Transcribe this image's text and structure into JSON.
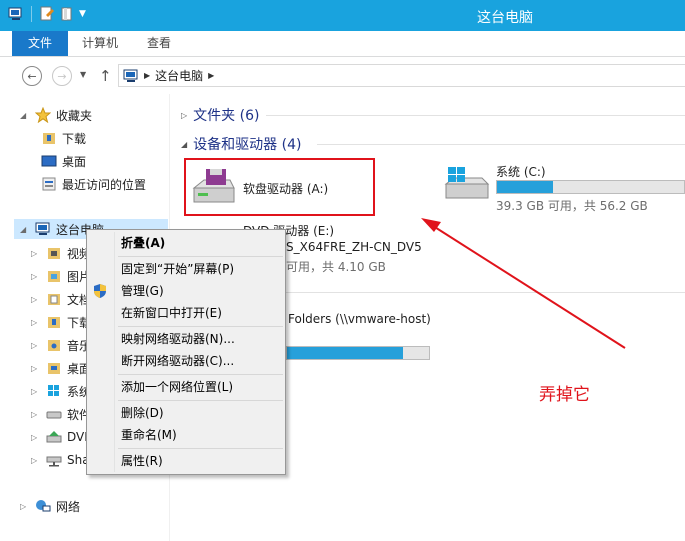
{
  "window": {
    "title": "这台电脑"
  },
  "ribbon": {
    "tabs": [
      "文件",
      "计算机",
      "查看"
    ]
  },
  "address": {
    "path": "这台电脑"
  },
  "nav": {
    "favorites": "收藏夹",
    "downloads": "下载",
    "desktop": "桌面",
    "recent": "最近访问的位置",
    "thispc": "这台电脑",
    "children": [
      "视频",
      "图片",
      "文档",
      "下载",
      "音乐",
      "桌面",
      "系统",
      "软件",
      "DVD",
      "Shar"
    ],
    "network": "网络"
  },
  "content": {
    "folders_group": "文件夹 (6)",
    "drives_group": "设备和驱动器 (4)",
    "floppy": {
      "label": "软盘驱动器 (A:)"
    },
    "system": {
      "label": "系统 (C:)",
      "sub": "39.3 GB 可用，共 56.2 GB",
      "used_fraction": 0.3
    },
    "dvd": {
      "label": "DVD 驱动器 (E:)",
      "line2": "S_X64FRE_ZH-CN_DV5",
      "line3": "可用，共 4.10 GB"
    },
    "shared": {
      "label": "Folders (\\\\vmware-host)",
      "used_fraction": 0.82
    }
  },
  "context_menu": {
    "items": {
      "collapse": "折叠(A)",
      "pin_start": "固定到“开始”屏幕(P)",
      "manage": "管理(G)",
      "open_new": "在新窗口中打开(E)",
      "map_drive": "映射网络驱动器(N)...",
      "disconnect": "断开网络驱动器(C)...",
      "add_location": "添加一个网络位置(L)",
      "delete": "删除(D)",
      "rename": "重命名(M)",
      "properties": "属性(R)"
    }
  },
  "annotation": {
    "text": "弄掉它",
    "color": "#e0131b"
  },
  "colors": {
    "titlebar": "#19a3de",
    "file_tab": "#1979ca",
    "progress": "#26a0da"
  }
}
